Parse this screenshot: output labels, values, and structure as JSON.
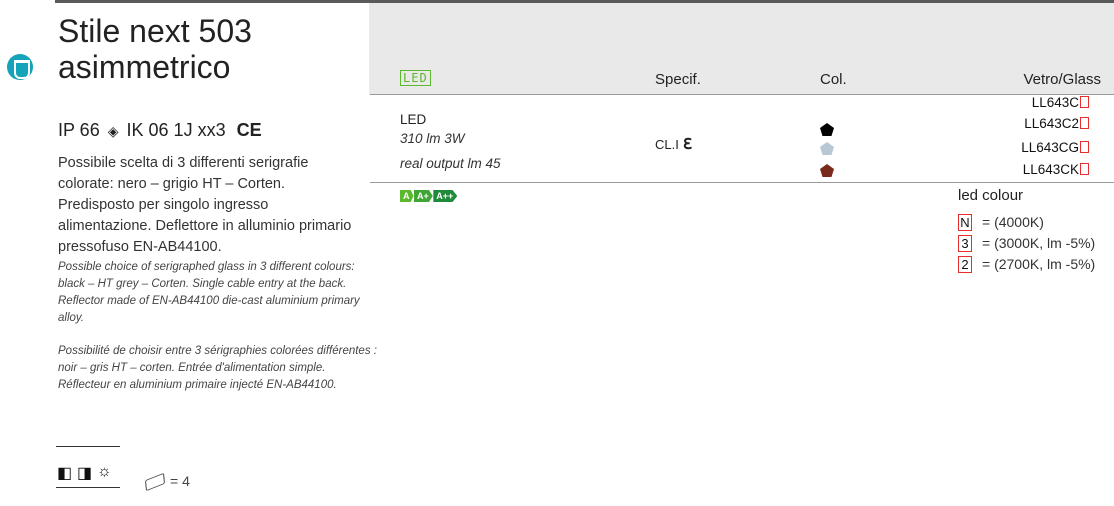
{
  "product": {
    "title_line1": "Stile next 503",
    "title_line2": "asimmetrico",
    "ip_rating": "IP 66",
    "ik_rating": "IK 06 1J xx3",
    "ce_mark": "CE",
    "desc_it": "Possibile scelta di 3 differenti serigrafie colorate: nero – grigio HT – Corten. Predisposto per singolo ingresso alimentazione. Deflettore in alluminio primario pressofuso EN-AB44100.",
    "desc_en": "Possible choice of serigraphed glass in 3 different colours: black – HT grey – Corten. Single cable entry at the back. Reflector made of EN-AB44100 die-cast aluminium primary alloy.",
    "desc_fr": "Possibilité de choisir entre 3 sérigraphies colorées différentes : noir – gris HT – corten. Entrée d'alimentation simple. Réflecteur en aluminium primaire injecté EN-AB44100.",
    "package_text": "= 4"
  },
  "table": {
    "header_led": "LED",
    "header_spec": "Specif.",
    "header_col": "Col.",
    "header_glass": "Vetro/Glass",
    "row": {
      "type": "LED",
      "spec_line1": "310 lm 3W",
      "spec_line2": "real output lm 45",
      "class": "CL.I",
      "class_symbol": "ℇ",
      "colors": [
        "#000000",
        "#b8c7d3",
        "#7a2a1a"
      ],
      "codes": [
        "LL643C",
        "LL643C2",
        "LL643CG",
        "LL643CK"
      ]
    },
    "energy_classes": [
      "A",
      "A+",
      "A++"
    ],
    "energy_colors": [
      "#5cb82d",
      "#3fa535",
      "#1f8a3a"
    ]
  },
  "legend": {
    "title": "led colour",
    "items": [
      {
        "key": "N",
        "text": "= (4000K)"
      },
      {
        "key": "3",
        "text": "= (3000K, lm -5%)"
      },
      {
        "key": "2",
        "text": "= (2700K, lm -5%)"
      }
    ]
  },
  "colors": {
    "accent": "#14a3b8",
    "code_box": "#e62e2e",
    "energy_green": "#5cb82d"
  }
}
